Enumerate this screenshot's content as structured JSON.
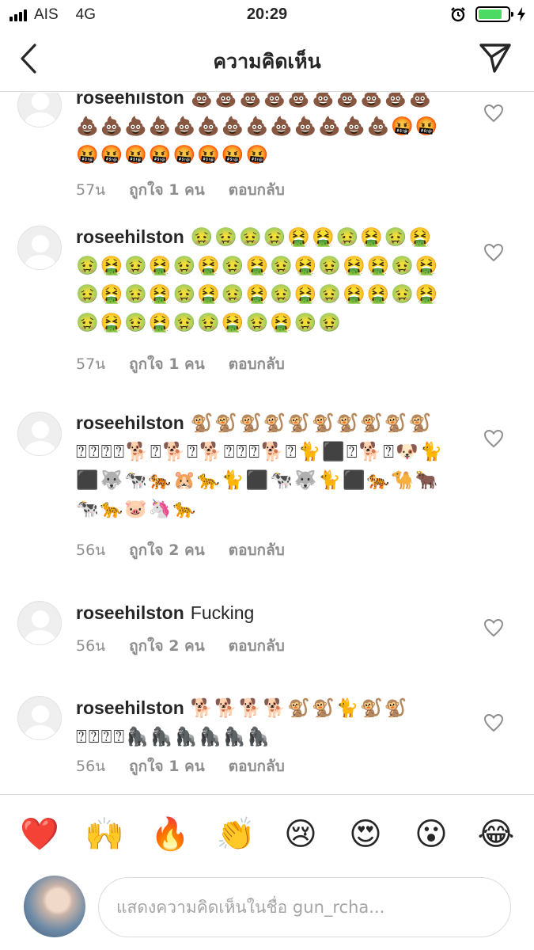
{
  "status_bar": {
    "carrier": "AIS",
    "network": "4G",
    "time": "20:29",
    "battery_level": 0.8
  },
  "nav": {
    "title": "ความคิดเห็น",
    "back_icon": "chevron-left-icon",
    "send_icon": "paper-plane-icon"
  },
  "comments": [
    {
      "username": "roseehilston",
      "text": "💩💩💩💩💩💩💩💩💩💩💩💩💩💩💩💩💩💩💩💩💩💩💩🤬🤬🤬🤬🤬🤬🤬🤬🤬🤬",
      "time": "57น",
      "likes": "ถูกใจ 1 คน",
      "reply": "ตอบกลับ"
    },
    {
      "username": "roseehilston",
      "text": "🤢🤢🤢🤢🤮🤮🤢🤮🤢🤮🤢🤮🤢🤮🤢🤮🤢🤮🤢🤮🤢🤮🤮🤢🤮🤢🤮🤢🤮🤢🤮🤢🤮🤢🤮🤢🤮🤮🤢🤮🤢🤮🤢🤮🤢🤢🤮🤢🤮🤢🤢",
      "time": "57น",
      "likes": "ถูกใจ 1 คน",
      "reply": "ตอบกลับ"
    },
    {
      "username": "roseehilston",
      "text": "🐒🐒🐒🐒🐒🐒🐒🐒🐒🐒⍰⍰⍰⍰🐕⍰🐕⍰🐕⍰⍰⍰🐕⍰🐈⬛⍰🐕⍰🐶🐈⬛🐺🐄🐅🐹🐆🐈⬛🐄🐺🐈⬛🐅🐪🐂🐄🐆🐷🦄🐆",
      "time": "56น",
      "likes": "ถูกใจ 2 คน",
      "reply": "ตอบกลับ"
    },
    {
      "username": "roseehilston",
      "text": "Fucking",
      "time": "56น",
      "likes": "ถูกใจ 2 คน",
      "reply": "ตอบกลับ"
    },
    {
      "username": "roseehilston",
      "text": "🐕🐕🐕🐕🐒🐒🐈🐒🐒⍰⍰⍰⍰🦍🦍🦍🦍🦍🦍",
      "time": "56น",
      "likes": "ถูกใจ 1 คน",
      "reply": "ตอบกลับ"
    }
  ],
  "emoji_bar": [
    "❤️",
    "🙌",
    "🔥",
    "👏",
    "😢",
    "😍",
    "😮",
    "😂"
  ],
  "composer": {
    "placeholder": "แสดงความคิดเห็นในชื่อ gun_rcha..."
  }
}
